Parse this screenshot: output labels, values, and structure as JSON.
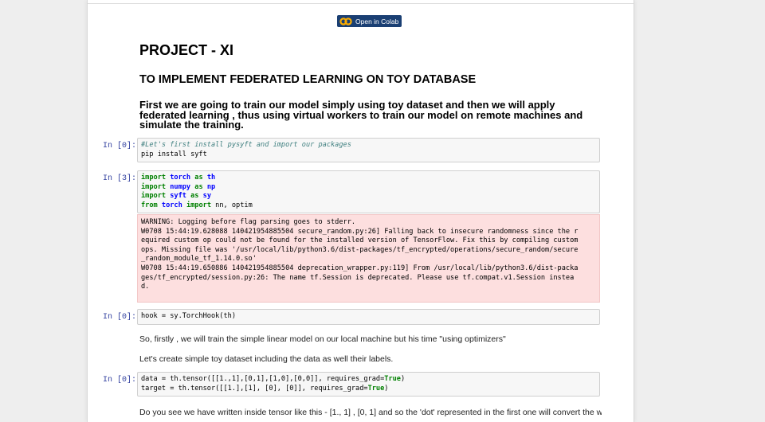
{
  "badge": {
    "label": "Open in Colab"
  },
  "headings": {
    "h1": "PROJECT - XI",
    "h2": "TO IMPLEMENT FEDERATED LEARNING ON TOY DATABASE",
    "h3": "First we are going to train our model simply using toy dataset and then we will apply federated learning , thus using virtual workers to train our model on remote machines and simulate the training."
  },
  "cells": [
    {
      "prompt": "In [0]:",
      "lines": [
        [
          {
            "t": "#Let's first install pysyft and import our packages",
            "c": "cm"
          }
        ],
        [
          {
            "t": "pip install syft",
            "c": ""
          }
        ]
      ]
    },
    {
      "prompt": "In [3]:",
      "lines": [
        [
          {
            "t": "import",
            "c": "kw"
          },
          {
            "t": " ",
            "c": ""
          },
          {
            "t": "torch",
            "c": "mod"
          },
          {
            "t": " ",
            "c": ""
          },
          {
            "t": "as",
            "c": "kw"
          },
          {
            "t": " ",
            "c": ""
          },
          {
            "t": "th",
            "c": "mod"
          }
        ],
        [
          {
            "t": "import",
            "c": "kw"
          },
          {
            "t": " ",
            "c": ""
          },
          {
            "t": "numpy",
            "c": "mod"
          },
          {
            "t": " ",
            "c": ""
          },
          {
            "t": "as",
            "c": "kw"
          },
          {
            "t": " ",
            "c": ""
          },
          {
            "t": "np",
            "c": "mod"
          }
        ],
        [
          {
            "t": "import",
            "c": "kw"
          },
          {
            "t": " ",
            "c": ""
          },
          {
            "t": "syft",
            "c": "mod"
          },
          {
            "t": " ",
            "c": ""
          },
          {
            "t": "as",
            "c": "kw"
          },
          {
            "t": " ",
            "c": ""
          },
          {
            "t": "sy",
            "c": "mod"
          }
        ],
        [
          {
            "t": "from",
            "c": "kw"
          },
          {
            "t": " ",
            "c": ""
          },
          {
            "t": "torch",
            "c": "mod"
          },
          {
            "t": " ",
            "c": ""
          },
          {
            "t": "import",
            "c": "kw"
          },
          {
            "t": " nn, optim",
            "c": ""
          }
        ]
      ],
      "output": [
        "WARNING: Logging before flag parsing goes to stderr.",
        "W0708 15:44:19.628088 140421954885504 secure_random.py:26] Falling back to insecure randomness since the r",
        "equired custom op could not be found for the installed version of TensorFlow. Fix this by compiling custom",
        "ops. Missing file was '/usr/local/lib/python3.6/dist-packages/tf_encrypted/operations/secure_random/secure",
        "_random_module_tf_1.14.0.so'",
        "W0708 15:44:19.650886 140421954885504 deprecation_wrapper.py:119] From /usr/local/lib/python3.6/dist-packa",
        "ges/tf_encrypted/session.py:26: The name tf.Session is deprecated. Please use tf.compat.v1.Session instea",
        "d."
      ]
    },
    {
      "prompt": "In [0]:",
      "lines": [
        [
          {
            "t": "hook = sy.TorchHook(th)",
            "c": ""
          }
        ]
      ]
    },
    {
      "prompt": "In [0]:",
      "lines": [
        [
          {
            "t": "data = th.tensor([[1.,1],[0,1],[1,0],[0,0]], requires_grad=",
            "c": ""
          },
          {
            "t": "True",
            "c": "kw"
          },
          {
            "t": ")",
            "c": ""
          }
        ],
        [
          {
            "t": "target = th.tensor([[1.],[1], [0], [0]], requires_grad=",
            "c": ""
          },
          {
            "t": "True",
            "c": "kw"
          },
          {
            "t": ")",
            "c": ""
          }
        ]
      ]
    }
  ],
  "paragraphs": {
    "p1": "So, firstly , we will train the simple linear model on our local machine but his time \"using optimizers\"",
    "p2": "Let's create simple toy dataset including the data as well their labels.",
    "p3": "Do you see we have written inside tensor like this - [1., 1] , [0, 1] and so the 'dot' represented in the first one will convert the whole"
  },
  "colors": {
    "prompt": "#303f9f",
    "badge": "#1a3f73",
    "error_bg": "#fddfdf"
  }
}
